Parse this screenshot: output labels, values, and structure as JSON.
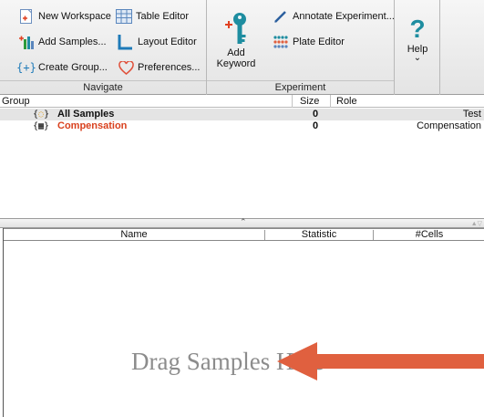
{
  "ribbon": {
    "navigate": {
      "label": "Navigate",
      "new_workspace": "New Workspace",
      "table_editor": "Table Editor",
      "add_samples": "Add Samples...",
      "layout_editor": "Layout Editor",
      "create_group": "Create Group...",
      "preferences": "Preferences..."
    },
    "experiment": {
      "label": "Experiment",
      "add_keyword_line1": "Add",
      "add_keyword_line2": "Keyword",
      "annotate": "Annotate Experiment...",
      "plate_editor": "Plate Editor"
    },
    "help": {
      "label": "Help",
      "glyph": "?",
      "chevron": "⌄"
    }
  },
  "groups_table": {
    "headers": {
      "group": "Group",
      "size": "Size",
      "role": "Role"
    },
    "rows": [
      {
        "name": "All Samples",
        "size": "0",
        "role": "Test",
        "color": "#111111",
        "selected": true
      },
      {
        "name": "Compensation",
        "size": "0",
        "role": "Compensation",
        "color": "#d9411e",
        "selected": false
      }
    ]
  },
  "splitter": {
    "handle": "⌃"
  },
  "stats_table": {
    "headers": {
      "name": "Name",
      "statistic": "Statistic",
      "cells": "#Cells"
    },
    "empty_text": "Drag Samples Here"
  },
  "colors": {
    "arrow": "#e0603f",
    "accent_red": "#d9411e",
    "icon_teal": "#1e8da0"
  }
}
